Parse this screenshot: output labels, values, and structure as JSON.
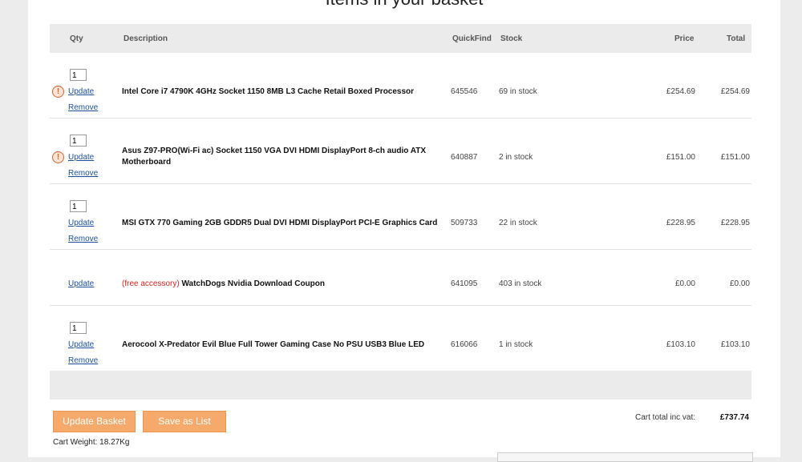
{
  "page_title": "Items in your basket",
  "columns": {
    "qty": "Qty",
    "description": "Description",
    "quickfind": "QuickFind",
    "stock": "Stock",
    "price": "Price",
    "total": "Total"
  },
  "items": [
    {
      "qty": "1",
      "warning": true,
      "update": "Update",
      "remove": "Remove",
      "free_prefix": "",
      "description": "Intel Core i7 4790K 4GHz Socket 1150 8MB L3 Cache Retail Boxed Processor",
      "quickfind": "645546",
      "stock": "69 in stock",
      "price": "£254.69",
      "total": "£254.69"
    },
    {
      "qty": "1",
      "warning": true,
      "update": "Update",
      "remove": "Remove",
      "free_prefix": "",
      "description": "Asus Z97-PRO(Wi-Fi ac) Socket 1150 VGA DVI HDMI DisplayPort 8-ch audio ATX Motherboard",
      "quickfind": "640887",
      "stock": "2 in stock",
      "price": "£151.00",
      "total": "£151.00"
    },
    {
      "qty": "1",
      "warning": false,
      "update": "Update",
      "remove": "Remove",
      "free_prefix": "",
      "description": "MSI GTX 770 Gaming 2GB GDDR5 Dual DVI HDMI DisplayPort PCI-E Graphics Card",
      "quickfind": "509733",
      "stock": "22 in stock",
      "price": "£228.95",
      "total": "£228.95"
    },
    {
      "qty": "",
      "warning": false,
      "update": "Update",
      "remove": "",
      "free_prefix": "(free accessory)",
      "description": "WatchDogs Nvidia Download Coupon",
      "quickfind": "641095",
      "stock": "403 in stock",
      "price": "£0.00",
      "total": "£0.00"
    },
    {
      "qty": "1",
      "warning": false,
      "update": "Update",
      "remove": "Remove",
      "free_prefix": "",
      "description": "Aerocool X-Predator Evil Blue Full Tower Gaming Case No PSU USB3 Blue LED",
      "quickfind": "616066",
      "stock": "1 in stock",
      "price": "£103.10",
      "total": "£103.10"
    }
  ],
  "buttons": {
    "update_basket": "Update Basket",
    "save_as_list": "Save as List"
  },
  "cart_weight": "Cart Weight: 18.27Kg",
  "cart_total_label": "Cart total inc vat:",
  "cart_total_value": "£737.74",
  "warning_icon": "exclamation-icon",
  "accent_color": "#f5a96b"
}
